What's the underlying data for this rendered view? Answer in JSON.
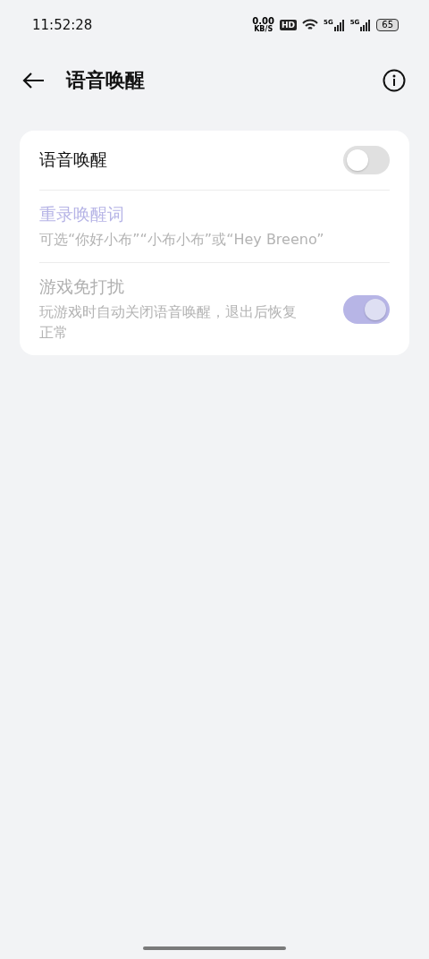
{
  "status_bar": {
    "time": "11:52:28",
    "speed": "0.00",
    "speed_unit": "KB/S",
    "hd": "HD",
    "networks": [
      "5G",
      "5G"
    ],
    "battery": "65"
  },
  "header": {
    "title": "语音唤醒"
  },
  "settings": [
    {
      "kind": "toggle",
      "title": "语音唤醒",
      "disabled": false,
      "on": false
    },
    {
      "kind": "link",
      "title": "重录唤醒词",
      "description": "可选“你好小布”“小布小布”或“Hey Breeno”",
      "disabled": true
    },
    {
      "kind": "toggle",
      "title": "游戏免打扰",
      "description": "玩游戏时自动关闭语音唤醒，退出后恢复正常",
      "disabled": true,
      "on": true
    }
  ]
}
